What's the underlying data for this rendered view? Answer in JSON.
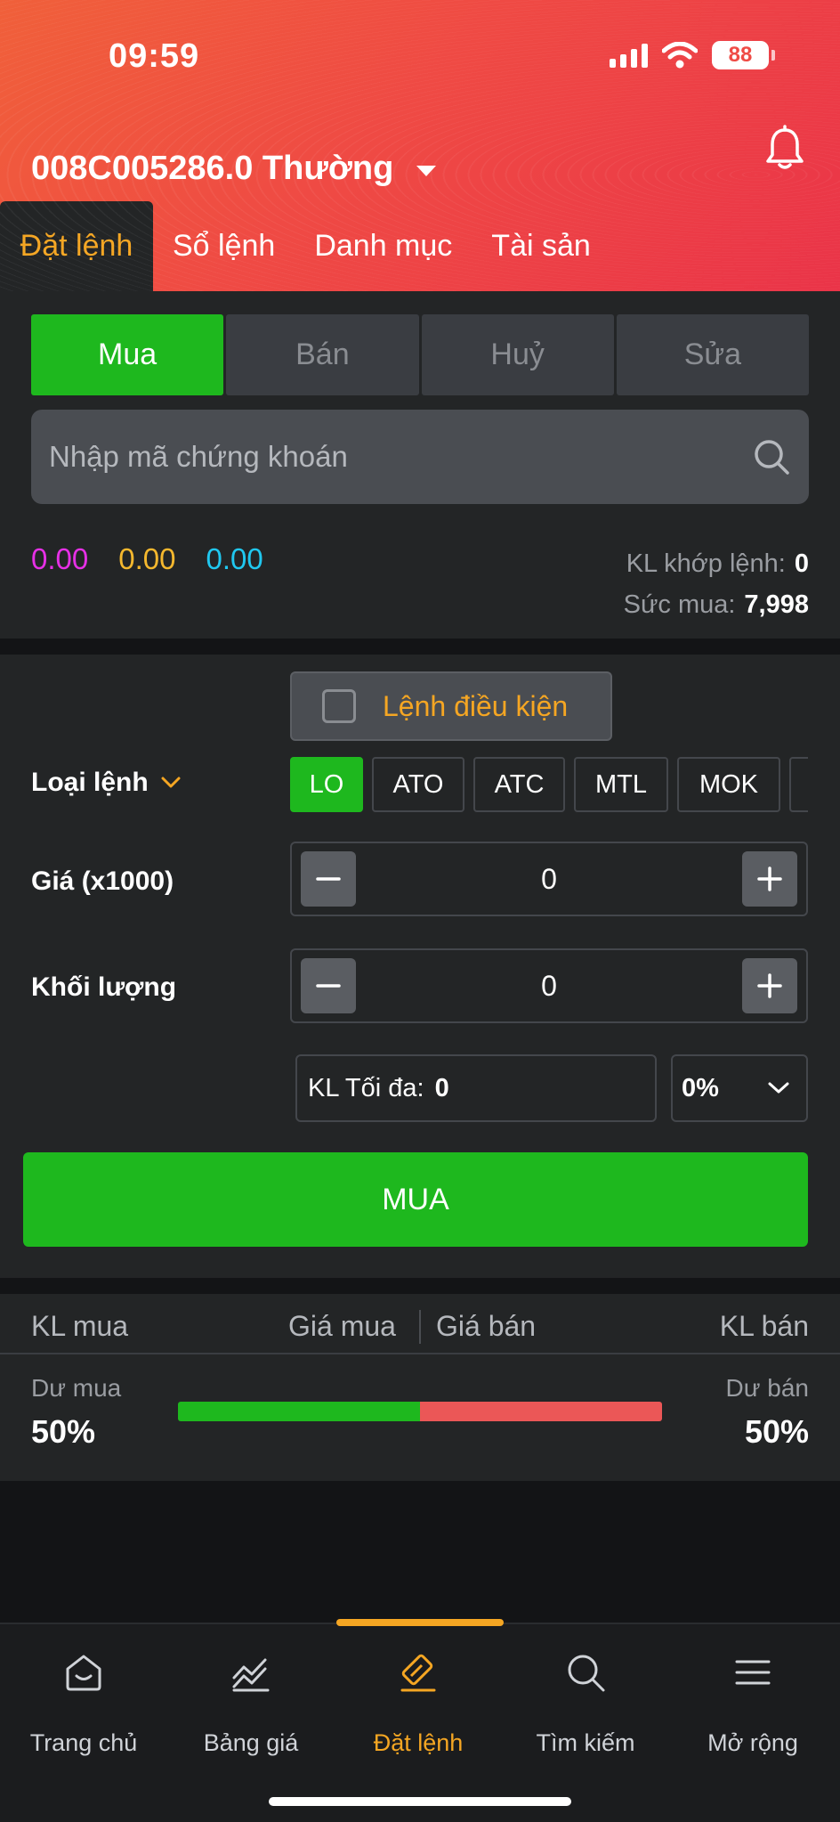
{
  "status": {
    "time": "09:59",
    "battery": "88"
  },
  "header": {
    "account": "008C005286.0 Thường"
  },
  "top_tabs": [
    {
      "label": "Đặt lệnh"
    },
    {
      "label": "Sổ lệnh"
    },
    {
      "label": "Danh mục"
    },
    {
      "label": "Tài sản"
    }
  ],
  "trade_side": [
    {
      "label": "Mua"
    },
    {
      "label": "Bán"
    },
    {
      "label": "Huỷ"
    },
    {
      "label": "Sửa"
    }
  ],
  "search": {
    "placeholder": "Nhập mã chứng khoán"
  },
  "prices": {
    "ceiling": "0.00",
    "reference": "0.00",
    "floor": "0.00"
  },
  "info": {
    "matched_label": "KL khớp lệnh:",
    "matched_value": "0",
    "power_label": "Sức mua:",
    "power_value": "7,998"
  },
  "conditional": {
    "label": "Lệnh điều kiện"
  },
  "order_type": {
    "label": "Loại lệnh",
    "options": [
      "LO",
      "ATO",
      "ATC",
      "MTL",
      "MOK"
    ]
  },
  "price": {
    "label": "Giá (x1000)",
    "value": "0"
  },
  "volume": {
    "label": "Khối lượng",
    "value": "0"
  },
  "max": {
    "label": "KL Tối đa:",
    "value": "0"
  },
  "percent": {
    "value": "0%"
  },
  "submit": {
    "label": "MUA"
  },
  "orderbook": {
    "buy_vol": "KL mua",
    "buy_price": "Giá mua",
    "sell_price": "Giá bán",
    "sell_vol": "KL bán",
    "surplus_buy_label": "Dư mua",
    "surplus_buy_value": "50%",
    "surplus_sell_label": "Dư bán",
    "surplus_sell_value": "50%",
    "buy_ratio": 0.5
  },
  "bottom_nav": [
    {
      "label": "Trang chủ",
      "icon": "home-icon"
    },
    {
      "label": "Bảng giá",
      "icon": "chart-icon"
    },
    {
      "label": "Đặt lệnh",
      "icon": "order-icon"
    },
    {
      "label": "Tìm kiếm",
      "icon": "search-icon"
    },
    {
      "label": "Mở rộng",
      "icon": "menu-icon"
    }
  ],
  "colors": {
    "accent": "#f5a623",
    "buy": "#1eb81e",
    "sell": "#eb5757"
  }
}
